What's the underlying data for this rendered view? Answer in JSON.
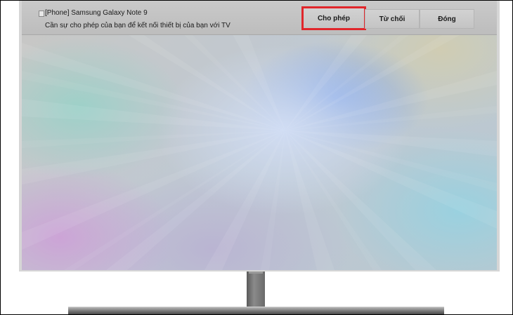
{
  "notification": {
    "title": "[Phone] Samsung Galaxy Note 9",
    "message": "Cần sự cho phép của bạn để kết nối thiết bị của bạn với TV",
    "icon": "device-icon"
  },
  "buttons": {
    "allow_label": "Cho phép",
    "deny_label": "Từ chối",
    "close_label": "Đóng"
  },
  "highlight": {
    "color": "#e0262b",
    "target": "allow-button"
  }
}
